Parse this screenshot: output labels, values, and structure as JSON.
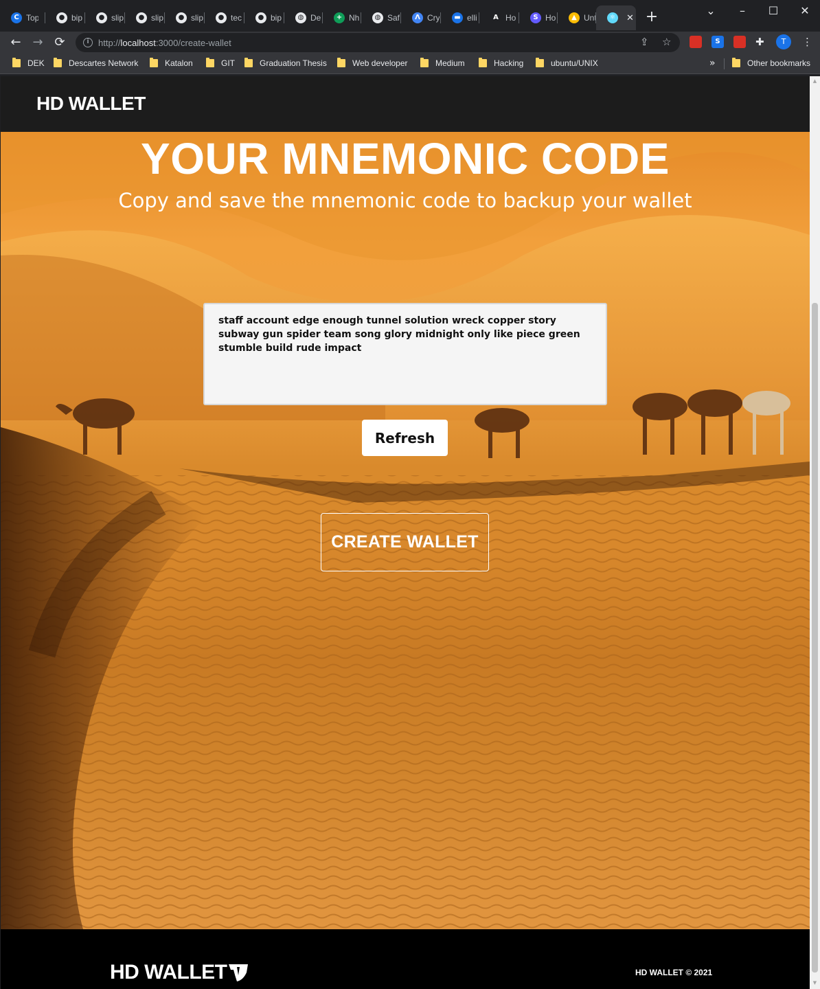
{
  "browser": {
    "tabs": [
      {
        "title": "Top",
        "icon": "c-icon",
        "color": "#1a73e8"
      },
      {
        "title": "bip",
        "icon": "github-icon",
        "color": "#e8eaed"
      },
      {
        "title": "slip",
        "icon": "github-icon",
        "color": "#e8eaed"
      },
      {
        "title": "slip",
        "icon": "github-icon",
        "color": "#e8eaed"
      },
      {
        "title": "slip",
        "icon": "github-icon",
        "color": "#e8eaed"
      },
      {
        "title": "tec",
        "icon": "github-icon",
        "color": "#e8eaed"
      },
      {
        "title": "bip",
        "icon": "github-icon",
        "color": "#e8eaed"
      },
      {
        "title": "De",
        "icon": "globe-icon",
        "color": "#e8eaed"
      },
      {
        "title": "Nh",
        "icon": "plus-icon",
        "color": "#0f9d58"
      },
      {
        "title": "Saf",
        "icon": "globe-icon",
        "color": "#e8eaed"
      },
      {
        "title": "Cry",
        "icon": "lambda-icon",
        "color": "#4285f4"
      },
      {
        "title": "elli",
        "icon": "dash-icon",
        "color": "#1a73e8"
      },
      {
        "title": "Ho",
        "icon": "a-icon",
        "color": "#202124"
      },
      {
        "title": "Ho",
        "icon": "s-icon",
        "color": "#635bff"
      },
      {
        "title": "Unt",
        "icon": "drive-icon",
        "color": "#fbbc04"
      },
      {
        "title": "",
        "icon": "react-icon",
        "color": "#61dafb",
        "active": true
      }
    ],
    "url_host": "localhost",
    "url_prefix": "http://",
    "url_rest": ":3000/create-wallet",
    "bookmarks": [
      "DEK",
      "Descartes Network",
      "Katalon",
      "GIT",
      "Graduation Thesis",
      "Web developer",
      "Medium",
      "Hacking",
      "ubuntu/UNIX"
    ],
    "other_bookmarks": "Other bookmarks",
    "profile_initial": "T",
    "extensions": [
      {
        "label": "",
        "color": "#d93025",
        "icon": "extension-red-icon"
      },
      {
        "label": "S",
        "color": "#1a73e8",
        "icon": "extension-s-icon"
      },
      {
        "label": "",
        "color": "#d93025",
        "icon": "extension-bug-icon"
      }
    ]
  },
  "header": {
    "brand": "HD WALLET"
  },
  "hero": {
    "title": "YOUR MNEMONIC CODE",
    "subtitle": "Copy and save the mnemonic code to backup your wallet",
    "mnemonic": "staff account edge enough tunnel solution wreck copper story subway gun spider team song glory midnight only like piece green stumble build rude impact",
    "refresh_label": "Refresh",
    "create_label": "CREATE WALLET"
  },
  "footer": {
    "logo_text": "HD WALLET",
    "copyright": "HD WALLET © 2021"
  },
  "colors": {
    "header_bg": "#1c1c1c",
    "footer_bg": "#000000",
    "sand": "#e29640"
  }
}
